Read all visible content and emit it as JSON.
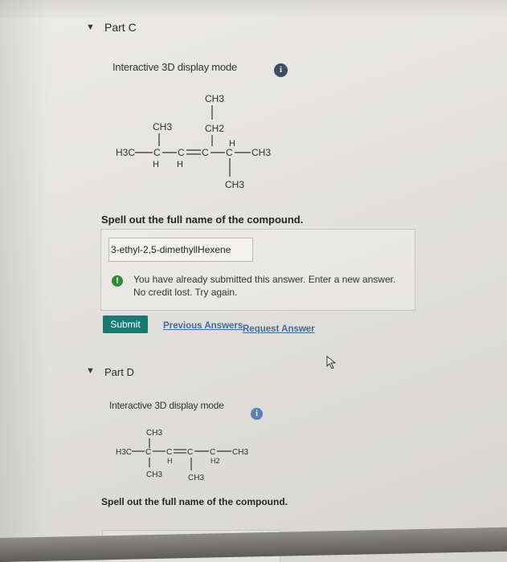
{
  "partC": {
    "title": "Part C",
    "display_mode": "Interactive 3D display mode",
    "info_icon": "i",
    "molecule": {
      "top1": "CH3",
      "top2": "CH2",
      "branch_left": "CH3",
      "main_left": "H3C",
      "c1": "C",
      "c2": "C",
      "c3": "C",
      "c4": "C",
      "h_above_c4": "H",
      "main_right": "CH3",
      "h_below_c1": "H",
      "h_below_c2": "H",
      "bottom": "CH3"
    },
    "question": "Spell out the full name of the compound.",
    "answer_value": "3-ethyl-2,5-dimethyllHexene",
    "feedback_line1": "You have already submitted this answer. Enter a new answer.",
    "feedback_line2": "No credit lost. Try again.",
    "submit_label": "Submit",
    "previous_answers": "Previous Answers",
    "request_answer": "Request Answer"
  },
  "partD": {
    "title": "Part D",
    "display_mode": "Interactive 3D display mode",
    "info_icon": "i",
    "molecule": {
      "top": "CH3",
      "main_left": "H3C",
      "c1": "C",
      "c2": "C",
      "c3": "C",
      "c4": "C",
      "main_right": "CH3",
      "h_below_c2": "H",
      "h2_below_c4": "H2",
      "bottom1": "CH3",
      "bottom2": "CH3"
    },
    "question": "Spell out the full name of the compound."
  },
  "icons": {
    "caret": "triangle-down-icon",
    "info": "info-icon",
    "warning": "exclamation-icon",
    "cursor": "mouse-pointer-icon"
  },
  "colors": {
    "submit": "#197a74",
    "link": "#3b6ea5",
    "feedback_icon": "#2e8b3a",
    "info": "#3b4c63"
  }
}
